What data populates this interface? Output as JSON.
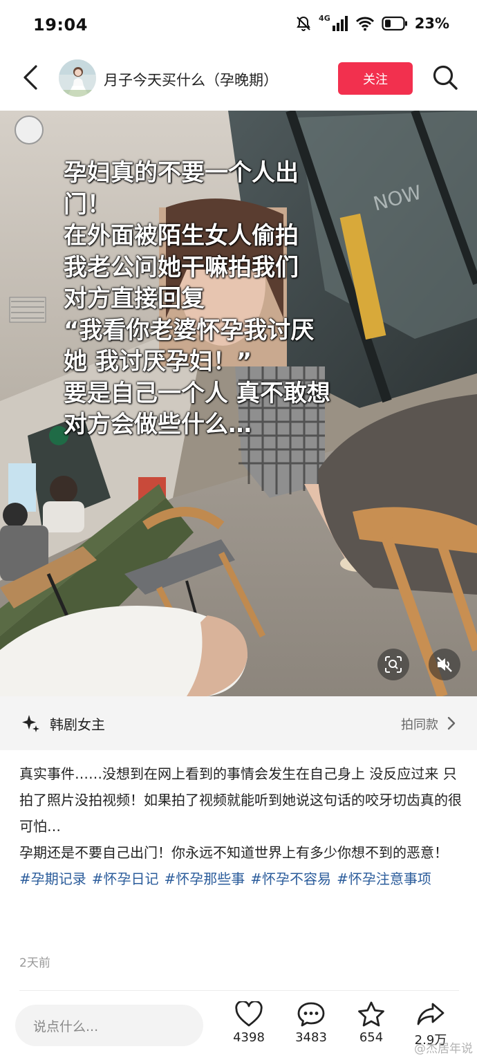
{
  "status_bar": {
    "time": "19:04",
    "network": "4G",
    "battery": "23%"
  },
  "header": {
    "author": "月子今天买什么（孕晚期）",
    "follow_label": "关注"
  },
  "media": {
    "overlay_lines": [
      "孕妇真的不要一个人出",
      "门！",
      "在外面被陌生女人偷拍",
      "我老公问她干嘛拍我们",
      "对方直接回复",
      "“我看你老婆怀孕我讨厌",
      "她 我讨厌孕妇！”",
      "要是自己一个人 真不敢想",
      "对方会做些什么…"
    ],
    "sign_text": "NOW"
  },
  "music": {
    "title": "韩剧女主",
    "same_style_label": "拍同款"
  },
  "description": {
    "paragraph1": "真实事件……没想到在网上看到的事情会发生在自己身上  没反应过来 只拍了照片没拍视频！如果拍了视频就能听到她说这句话的咬牙切齿真的很可怕…",
    "paragraph2": "孕期还是不要自己出门！你永远不知道世界上有多少你想不到的恶意！",
    "tags": [
      "#孕期记录",
      "#怀孕日记",
      "#怀孕那些事",
      "#怀孕不容易",
      "#怀孕注意事项"
    ],
    "time_ago": "2天前"
  },
  "bottom_bar": {
    "comment_placeholder": "说点什么...",
    "likes": "4398",
    "comments": "3483",
    "favorites": "654",
    "shares": "2.9万"
  },
  "watermark": "@杰居年说",
  "colors": {
    "accent": "#f2304e",
    "tag": "#2b5c9b"
  }
}
